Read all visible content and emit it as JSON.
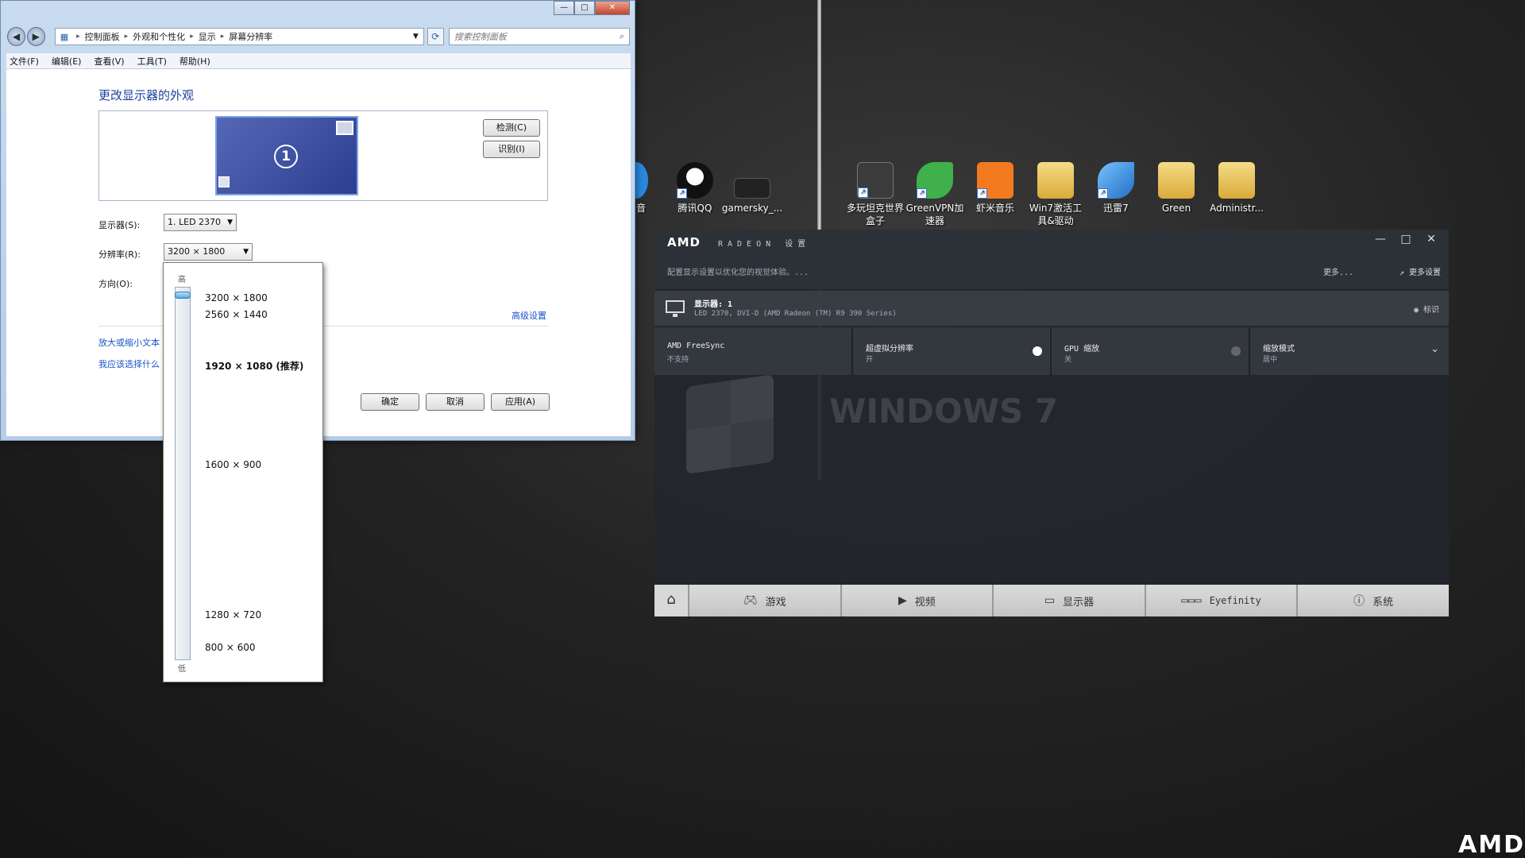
{
  "control_panel": {
    "breadcrumbs": [
      "控制面板",
      "外观和个性化",
      "显示",
      "屏幕分辨率"
    ],
    "search_placeholder": "搜索控制面板",
    "menu": [
      "文件(F)",
      "编辑(E)",
      "查看(V)",
      "工具(T)",
      "帮助(H)"
    ],
    "title": "更改显示器的外观",
    "detect_label": "检测(C)",
    "identify_label": "识别(I)",
    "monitor_number": "1",
    "display_label": "显示器(S):",
    "display_value": "1. LED 2370",
    "resolution_label": "分辨率(R):",
    "resolution_value": "3200 × 1800",
    "orientation_label": "方向(O):",
    "advanced_link": "高级设置",
    "link_text_size": "放大或缩小文本",
    "link_which": "我应该选择什么",
    "ok_label": "确定",
    "cancel_label": "取消",
    "apply_label": "应用(A)"
  },
  "resolution_popup": {
    "high_label": "高",
    "low_label": "低",
    "options": [
      "3200 × 1800",
      "2560 × 1440",
      "1920 × 1080 (推荐)",
      "1600 × 900",
      "1280 × 720",
      "800 × 600"
    ],
    "selected": "3200 × 1800"
  },
  "desktop_icons": [
    {
      "label": "影音",
      "color": "#2a8ae0"
    },
    {
      "label": "腾讯QQ",
      "color": "#111111"
    },
    {
      "label": "gamersky_...",
      "color": "#222222"
    },
    {
      "label": "多玩坦克世界盒子",
      "color": "#3b3b3b"
    },
    {
      "label": "GreenVPN加速器",
      "color": "#3fb04a"
    },
    {
      "label": "虾米音乐",
      "color": "#f47a20"
    },
    {
      "label": "Win7激活工具&驱动",
      "color": "#e8c75a"
    },
    {
      "label": "迅雷7",
      "color": "#2f86d6"
    },
    {
      "label": "Green",
      "color": "#e8c75a"
    },
    {
      "label": "Administr...",
      "color": "#e8c75a"
    }
  ],
  "amd": {
    "logo": "AMD",
    "brand": "RADEON 设置",
    "subtitle": "配置显示设置以优化您的视觉体验。...",
    "more": "更多...",
    "more_settings": "更多设置",
    "display_title": "显示器: 1",
    "display_sub": "LED 2370, DVI-D (AMD Radeon (TM) R9 390 Series)",
    "identify": "标识",
    "settings": [
      {
        "title": "AMD FreeSync",
        "value": "不支持"
      },
      {
        "title": "超虚拟分辨率",
        "value": "开"
      },
      {
        "title": "GPU 缩放",
        "value": "关"
      },
      {
        "title": "缩放模式",
        "value": "居中"
      }
    ],
    "watermark": "WINDOWS 7",
    "nav": [
      "游戏",
      "视频",
      "显示器",
      "Eyefinity",
      "系统"
    ],
    "corner_logo": "AMD"
  },
  "colors": {
    "win7_link": "#1a55c7",
    "amd_bg": "#22262c",
    "amd_nav": "#c4c4c4"
  }
}
